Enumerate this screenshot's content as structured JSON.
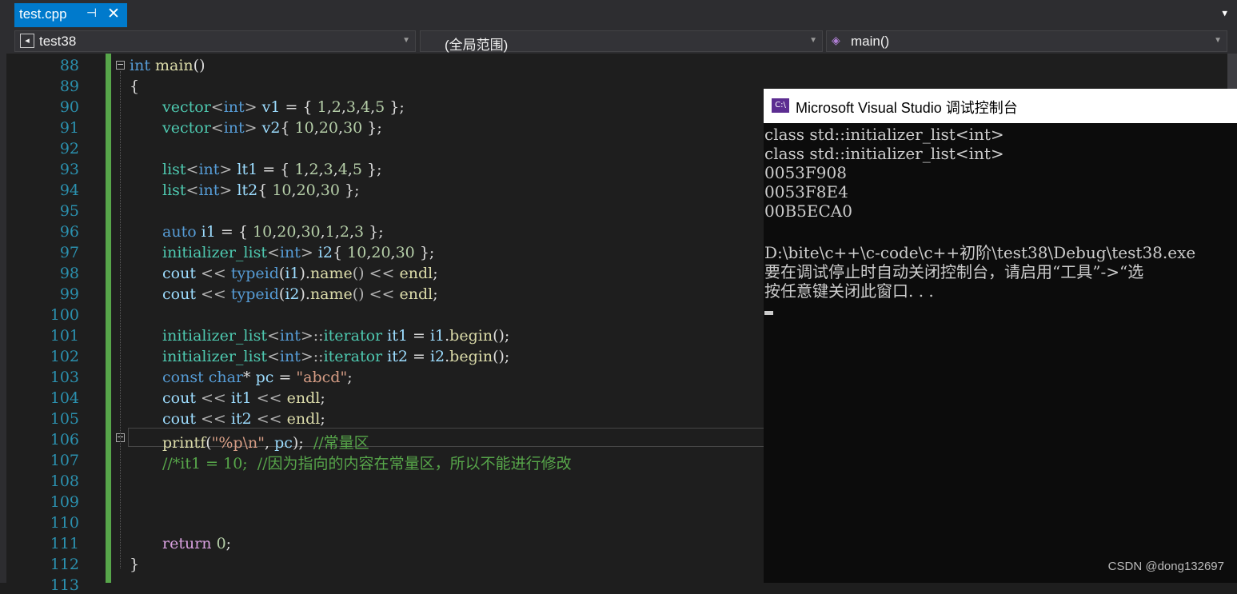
{
  "tab": {
    "title": "test.cpp",
    "pin_glyph": "⊣",
    "close_glyph": "✕"
  },
  "nav": {
    "project": "test38",
    "scope": "(全局范围)",
    "member": "main()"
  },
  "line_numbers": [
    "88",
    "89",
    "90",
    "91",
    "92",
    "93",
    "94",
    "95",
    "96",
    "97",
    "98",
    "99",
    "100",
    "101",
    "102",
    "103",
    "104",
    "105",
    "106",
    "107",
    "108",
    "109",
    "110",
    "111",
    "112"
  ],
  "code": {
    "l88": [
      "int",
      " main",
      "()"
    ],
    "l89": "{",
    "l90": [
      "vector",
      "<",
      "int",
      ">",
      " v1",
      " = { ",
      "1",
      ",",
      "2",
      ",",
      "3",
      ",",
      "4",
      ",",
      "5",
      " };"
    ],
    "l91": [
      "vector",
      "<",
      "int",
      ">",
      " v2",
      "{ ",
      "10",
      ",",
      "20",
      ",",
      "30",
      " };"
    ],
    "l93": [
      "list",
      "<",
      "int",
      ">",
      " lt1",
      " = { ",
      "1",
      ",",
      "2",
      ",",
      "3",
      ",",
      "4",
      ",",
      "5",
      " };"
    ],
    "l94": [
      "list",
      "<",
      "int",
      ">",
      " lt2",
      "{ ",
      "10",
      ",",
      "20",
      ",",
      "30",
      " };"
    ],
    "l96": [
      "auto",
      " i1",
      " = { ",
      "10",
      ",",
      "20",
      ",",
      "30",
      ",",
      "1",
      ",",
      "2",
      ",",
      "3",
      " };"
    ],
    "l97": [
      "initializer_list",
      "<",
      "int",
      ">",
      " i2",
      "{ ",
      "10",
      ",",
      "20",
      ",",
      "30",
      " };"
    ],
    "l98": [
      "cout",
      " << ",
      "typeid",
      "(",
      "i1",
      ").",
      "name",
      "() << ",
      "endl",
      ";"
    ],
    "l99": [
      "cout",
      " << ",
      "typeid",
      "(",
      "i2",
      ").",
      "name",
      "() << ",
      "endl",
      ";"
    ],
    "l101": [
      "initializer_list",
      "<",
      "int",
      ">::",
      "iterator",
      " it1",
      " = ",
      "i1",
      ".",
      "begin",
      "();"
    ],
    "l102": [
      "initializer_list",
      "<",
      "int",
      ">::",
      "iterator",
      " it2",
      " = ",
      "i2",
      ".",
      "begin",
      "();"
    ],
    "l103": [
      "const",
      " ",
      "char",
      "* ",
      "pc",
      " = ",
      "\"abcd\"",
      ";"
    ],
    "l104": [
      "cout",
      " << ",
      "it1",
      " << ",
      "endl",
      ";"
    ],
    "l105": [
      "cout",
      " << ",
      "it2",
      " << ",
      "endl",
      ";"
    ],
    "l106": [
      "printf",
      "(",
      "\"%p\\n\"",
      ", ",
      "pc",
      ");  ",
      "//常量区"
    ],
    "l107": "//*it1 = 10;  //因为指向的内容在常量区，所以不能进行修改",
    "l111": [
      "return",
      " ",
      "0",
      ";"
    ],
    "l112": "}",
    "l113": "113"
  },
  "console": {
    "icon_text": "C:\\",
    "title": "Microsoft Visual Studio 调试控制台",
    "lines": [
      "class std::initializer_list<int>",
      "class std::initializer_list<int>",
      "0053F908",
      "0053F8E4",
      "00B5ECA0",
      "",
      "D:\\bite\\c++\\c-code\\c++初阶\\test38\\Debug\\test38.exe",
      "要在调试停止时自动关闭控制台，请启用“工具”->“选",
      "按任意键关闭此窗口. . ."
    ]
  },
  "watermark": "CSDN @dong132697"
}
